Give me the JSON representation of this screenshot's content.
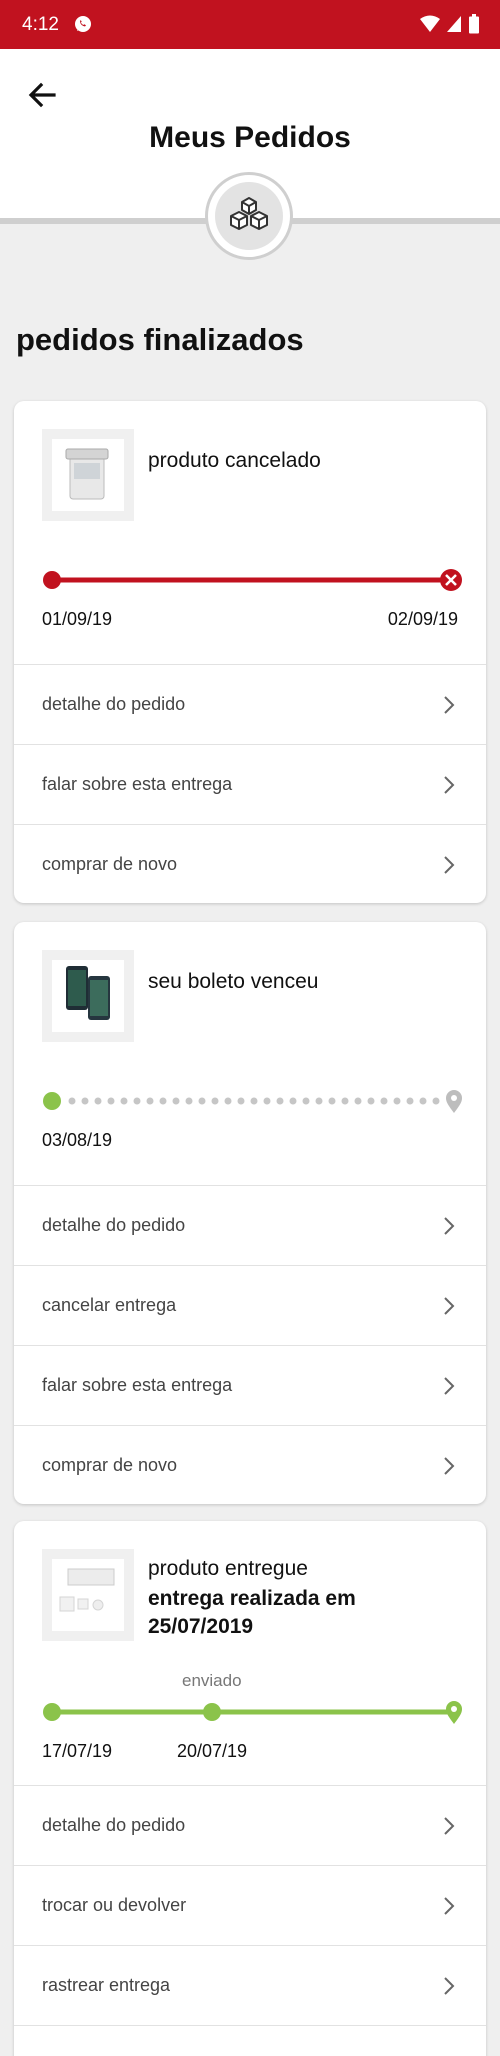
{
  "status_bar": {
    "time": "4:12",
    "whatsapp_icon": "whatsapp-icon",
    "icons": [
      "wifi-icon",
      "signal-icon",
      "battery-icon"
    ]
  },
  "header": {
    "title": "Meus Pedidos",
    "back_icon": "back-arrow-icon",
    "emblem_icon": "boxes-icon"
  },
  "section_title": "pedidos finalizados",
  "colors": {
    "brand_red": "#c1121f",
    "green": "#8bc34a",
    "grey": "#bdbdbd"
  },
  "orders": [
    {
      "status": "produto cancelado",
      "track": {
        "start_date": "01/09/19",
        "end_date": "02/09/19",
        "state": "cancelled"
      },
      "actions": [
        "detalhe do pedido",
        "falar sobre esta entrega",
        "comprar de novo"
      ]
    },
    {
      "status": "seu boleto venceu",
      "track": {
        "start_date": "03/08/19",
        "state": "pending"
      },
      "actions": [
        "detalhe do pedido",
        "cancelar entrega",
        "falar sobre esta entrega",
        "comprar de novo"
      ]
    },
    {
      "status": "produto entregue",
      "status_sub": "entrega realizada em 25/07/2019",
      "track": {
        "start_date": "17/07/19",
        "mid_date": "20/07/19",
        "mid_label": "enviado",
        "state": "delivered"
      },
      "actions": [
        "detalhe do pedido",
        "trocar ou devolver",
        "rastrear entrega"
      ]
    }
  ]
}
